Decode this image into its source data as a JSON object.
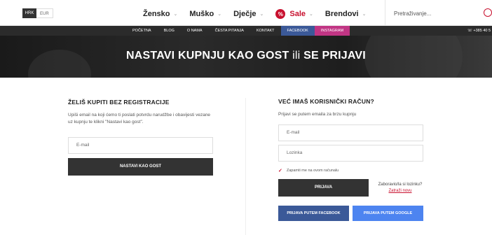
{
  "header": {
    "currencies": [
      "HRK",
      "EUR"
    ],
    "nav": [
      {
        "label": "Žensko"
      },
      {
        "label": "Muško"
      },
      {
        "label": "Dječje"
      },
      {
        "label": "Sale",
        "badge": "%"
      },
      {
        "label": "Brendovi"
      }
    ],
    "search_placeholder": "Pretraživanje..."
  },
  "subnav": {
    "items": [
      "POČETNA",
      "BLOG",
      "O NAMA",
      "ČESTA PITANJA",
      "KONTAKT",
      "FACEBOOK",
      "INSTAGRAM"
    ],
    "phone": "+385 40 5"
  },
  "hero": {
    "title_part1": "NASTAVI KUPNJU KAO GOST",
    "title_ili": "ili",
    "title_part2": "SE PRIJAVI"
  },
  "guest": {
    "title": "ŽELIŠ KUPITI BEZ REGISTRACIJE",
    "description": "Upiši email na koji ćemo ti poslati potvrdu narudžbe i obavijesti vezane uz kupnju te klikni \"Nastavi kao gost\".",
    "email_placeholder": "E-mail",
    "button": "NASTAVI KAO GOST"
  },
  "login": {
    "title": "VEĆ IMAŠ KORISNIČKI RAČUN?",
    "description": "Prijavi se putem emaila za brzu kupnju",
    "email_placeholder": "E-mail",
    "password_placeholder": "Lozinka",
    "remember_label": "Zapamti me na ovom računalu",
    "button": "PRIJAVA",
    "forgot_text": "Zaboravio/la si lozinku?",
    "forgot_link": "Zatraži novu",
    "facebook_button": "PRIJAVA PUTEM FACEBOOK",
    "google_button": "PRIJAVA PUTEM GOOGLE"
  },
  "colors": {
    "accent": "#c8102e",
    "facebook": "#3b5998",
    "google": "#4d84f0",
    "instagram": "#c13584",
    "dark": "#333333"
  }
}
